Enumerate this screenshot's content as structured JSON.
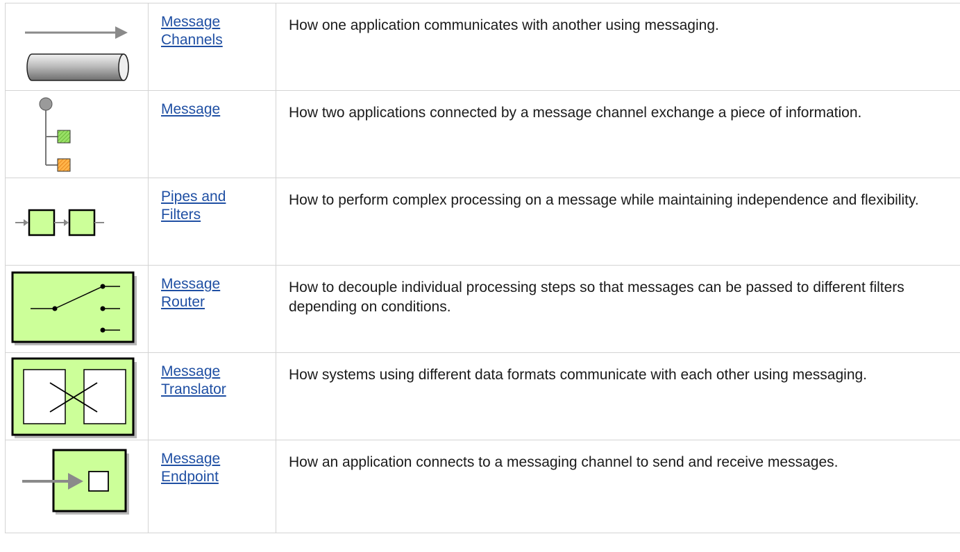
{
  "patterns": [
    {
      "icon": "message-channel-icon",
      "name": "Message\nChannels",
      "name_line1": "Message",
      "name_line2": "Channels",
      "description": "How one application communicates with another using messaging."
    },
    {
      "icon": "message-icon",
      "name_line1": "Message",
      "name_line2": "",
      "description": "How two applications connected by a message channel exchange a piece of information."
    },
    {
      "icon": "pipes-and-filters-icon",
      "name_line1": "Pipes and",
      "name_line2": "Filters",
      "description": "How to perform complex processing on a message while maintaining independence and flexibility."
    },
    {
      "icon": "message-router-icon",
      "name_line1": "Message",
      "name_line2": "Router",
      "description": "How to decouple individual processing steps so that messages can be passed to different filters depending on conditions."
    },
    {
      "icon": "message-translator-icon",
      "name_line1": "Message",
      "name_line2": "Translator",
      "description": "How systems using different data formats communicate with each other using messaging."
    },
    {
      "icon": "message-endpoint-icon",
      "name_line1": "Message",
      "name_line2": "Endpoint",
      "description": "How an application connects to a messaging channel to send and receive messages."
    }
  ],
  "colors": {
    "link": "#1f4fa3",
    "filter_fill": "#ccff99",
    "filter_border": "#000000",
    "border": "#d4d4d4"
  }
}
